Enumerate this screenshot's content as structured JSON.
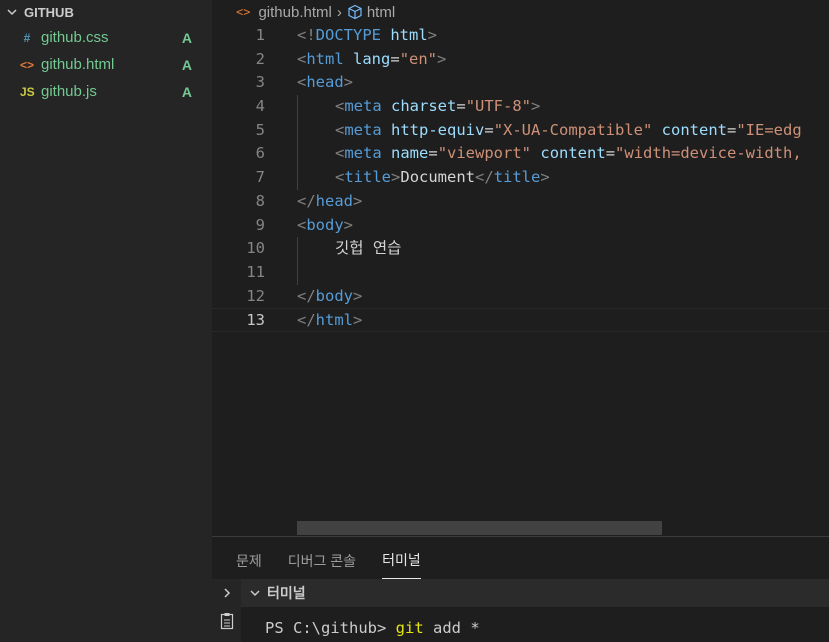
{
  "explorer": {
    "folder_name": "GITHUB",
    "files": [
      {
        "icon": "#",
        "icon_color": "#519aba",
        "name": "github.css",
        "status": "A"
      },
      {
        "icon": "<>",
        "icon_color": "#e37933",
        "name": "github.html",
        "status": "A"
      },
      {
        "icon": "JS",
        "icon_color": "#cbcb41",
        "name": "github.js",
        "status": "A"
      }
    ]
  },
  "breadcrumb": {
    "file": "github.html",
    "symbol": "html"
  },
  "editor": {
    "active_line": 13,
    "lines": [
      {
        "num": "1",
        "indent": 0,
        "tokens": [
          [
            "punc",
            "<!"
          ],
          [
            "tag",
            "DOCTYPE"
          ],
          [
            "text",
            " "
          ],
          [
            "attr",
            "html"
          ],
          [
            "punc",
            ">"
          ]
        ]
      },
      {
        "num": "2",
        "indent": 0,
        "tokens": [
          [
            "punc",
            "<"
          ],
          [
            "tag",
            "html"
          ],
          [
            "text",
            " "
          ],
          [
            "attr",
            "lang"
          ],
          [
            "text",
            "="
          ],
          [
            "str",
            "\"en\""
          ],
          [
            "punc",
            ">"
          ]
        ]
      },
      {
        "num": "3",
        "indent": 0,
        "tokens": [
          [
            "punc",
            "<"
          ],
          [
            "tag",
            "head"
          ],
          [
            "punc",
            ">"
          ]
        ]
      },
      {
        "num": "4",
        "indent": 1,
        "tokens": [
          [
            "punc",
            "<"
          ],
          [
            "tag",
            "meta"
          ],
          [
            "text",
            " "
          ],
          [
            "attr",
            "charset"
          ],
          [
            "text",
            "="
          ],
          [
            "str",
            "\"UTF-8\""
          ],
          [
            "punc",
            ">"
          ]
        ]
      },
      {
        "num": "5",
        "indent": 1,
        "tokens": [
          [
            "punc",
            "<"
          ],
          [
            "tag",
            "meta"
          ],
          [
            "text",
            " "
          ],
          [
            "attr",
            "http-equiv"
          ],
          [
            "text",
            "="
          ],
          [
            "str",
            "\"X-UA-Compatible\""
          ],
          [
            "text",
            " "
          ],
          [
            "attr",
            "content"
          ],
          [
            "text",
            "="
          ],
          [
            "str",
            "\"IE=edg"
          ]
        ]
      },
      {
        "num": "6",
        "indent": 1,
        "tokens": [
          [
            "punc",
            "<"
          ],
          [
            "tag",
            "meta"
          ],
          [
            "text",
            " "
          ],
          [
            "attr",
            "name"
          ],
          [
            "text",
            "="
          ],
          [
            "str",
            "\"viewport\""
          ],
          [
            "text",
            " "
          ],
          [
            "attr",
            "content"
          ],
          [
            "text",
            "="
          ],
          [
            "str",
            "\"width=device-width,"
          ]
        ]
      },
      {
        "num": "7",
        "indent": 1,
        "tokens": [
          [
            "punc",
            "<"
          ],
          [
            "tag",
            "title"
          ],
          [
            "punc",
            ">"
          ],
          [
            "text",
            "Document"
          ],
          [
            "punc",
            "</"
          ],
          [
            "tag",
            "title"
          ],
          [
            "punc",
            ">"
          ]
        ]
      },
      {
        "num": "8",
        "indent": 0,
        "tokens": [
          [
            "punc",
            "</"
          ],
          [
            "tag",
            "head"
          ],
          [
            "punc",
            ">"
          ]
        ]
      },
      {
        "num": "9",
        "indent": 0,
        "tokens": [
          [
            "punc",
            "<"
          ],
          [
            "tag",
            "body"
          ],
          [
            "punc",
            ">"
          ]
        ]
      },
      {
        "num": "10",
        "indent": 1,
        "tokens": [
          [
            "text",
            "깃헙 연습"
          ]
        ]
      },
      {
        "num": "11",
        "indent": 0,
        "tokens": []
      },
      {
        "num": "12",
        "indent": 0,
        "tokens": [
          [
            "punc",
            "</"
          ],
          [
            "tag",
            "body"
          ],
          [
            "punc",
            ">"
          ]
        ]
      },
      {
        "num": "13",
        "indent": 0,
        "tokens": [
          [
            "punc",
            "</"
          ],
          [
            "tag",
            "html"
          ],
          [
            "punc",
            ">"
          ]
        ]
      }
    ]
  },
  "panel": {
    "tabs": [
      {
        "label": "문제",
        "active": false
      },
      {
        "label": "디버그 콘솔",
        "active": false
      },
      {
        "label": "터미널",
        "active": true
      }
    ],
    "terminal_title": "터미널",
    "terminal_prompt": "PS C:\\github> ",
    "terminal_command": "git",
    "terminal_args": " add *"
  }
}
